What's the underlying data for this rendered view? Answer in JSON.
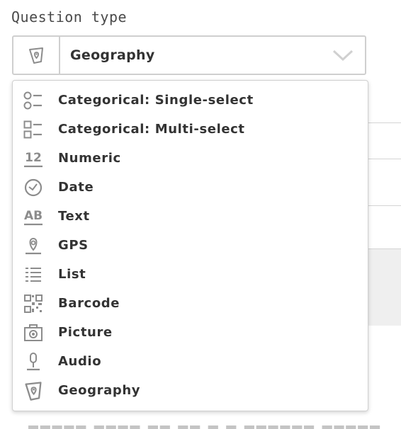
{
  "field": {
    "label": "Question type",
    "selected": "Geography",
    "selected_icon": "geography-icon"
  },
  "options": [
    {
      "label": "Categorical: Single-select",
      "icon": "single-select-icon"
    },
    {
      "label": "Categorical: Multi-select",
      "icon": "multi-select-icon"
    },
    {
      "label": "Numeric",
      "icon": "numeric-icon"
    },
    {
      "label": "Date",
      "icon": "clock-icon"
    },
    {
      "label": "Text",
      "icon": "text-ab-icon"
    },
    {
      "label": "GPS",
      "icon": "map-pin-icon"
    },
    {
      "label": "List",
      "icon": "list-icon"
    },
    {
      "label": "Barcode",
      "icon": "barcode-icon"
    },
    {
      "label": "Picture",
      "icon": "camera-icon"
    },
    {
      "label": "Audio",
      "icon": "microphone-icon"
    },
    {
      "label": "Geography",
      "icon": "geography-icon"
    }
  ],
  "colors": {
    "text": "#333333",
    "icon": "#8c8c8c",
    "border": "#cfcfcf"
  }
}
